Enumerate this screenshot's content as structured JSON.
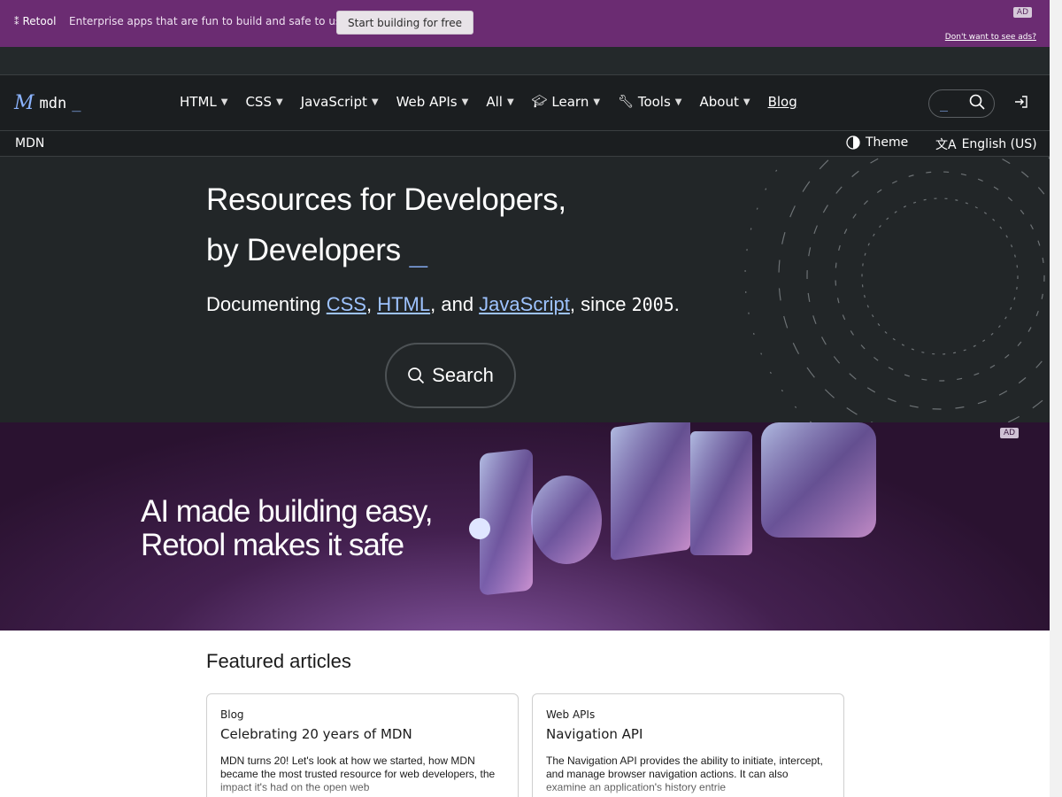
{
  "top_ad": {
    "brand": "Retool",
    "tagline": "Enterprise apps that are fun to build and safe to use",
    "cta": "Start building for free",
    "ad_label": "AD",
    "no_ads": "Don't want to see ads?"
  },
  "nav": {
    "logo_text": "mdn",
    "logo_cursor": "_",
    "items": [
      {
        "label": "HTML",
        "dropdown": true,
        "icon": ""
      },
      {
        "label": "CSS",
        "dropdown": true,
        "icon": ""
      },
      {
        "label": "JavaScript",
        "dropdown": true,
        "icon": ""
      },
      {
        "label": "Web APIs",
        "dropdown": true,
        "icon": ""
      },
      {
        "label": "All",
        "dropdown": true,
        "icon": ""
      },
      {
        "label": "Learn",
        "dropdown": true,
        "icon": "graduation-cap-icon"
      },
      {
        "label": "Tools",
        "dropdown": true,
        "icon": "wrench-icon"
      },
      {
        "label": "About",
        "dropdown": true,
        "icon": ""
      },
      {
        "label": "Blog",
        "dropdown": false,
        "icon": ""
      }
    ],
    "search_cursor": "_"
  },
  "breadcrumb": {
    "root": "MDN",
    "theme": "Theme",
    "language": "English (US)"
  },
  "hero": {
    "title_line1": "Resources for Developers,",
    "title_line2": "by Developers",
    "cursor": "_",
    "sub_prefix": "Documenting ",
    "link_css": "CSS",
    "sep1": ", ",
    "link_html": "HTML",
    "sep2": ", and ",
    "link_js": "JavaScript",
    "sub_suffix": ", since ",
    "year": "2005",
    "period": ".",
    "search_label": "Search"
  },
  "mid_ad": {
    "line1": "AI made building easy,",
    "line2": "Retool makes it safe",
    "ad_label": "AD"
  },
  "featured": {
    "heading": "Featured articles",
    "cards": [
      {
        "category": "Blog",
        "title": "Celebrating 20 years of MDN",
        "description": "MDN turns 20! Let's look at how we started, how MDN became the most trusted resource for web developers, the impact it's had on the open web"
      },
      {
        "category": "Web APIs",
        "title": "Navigation API",
        "description": "The Navigation API provides the ability to initiate, intercept, and manage browser navigation actions. It can also examine an application's history entrie"
      }
    ]
  },
  "colors": {
    "ad_purple": "#6b2c72",
    "nav_bg": "#1b1e20",
    "hero_bg": "#222628",
    "accent_blue": "#8cb4ff"
  }
}
